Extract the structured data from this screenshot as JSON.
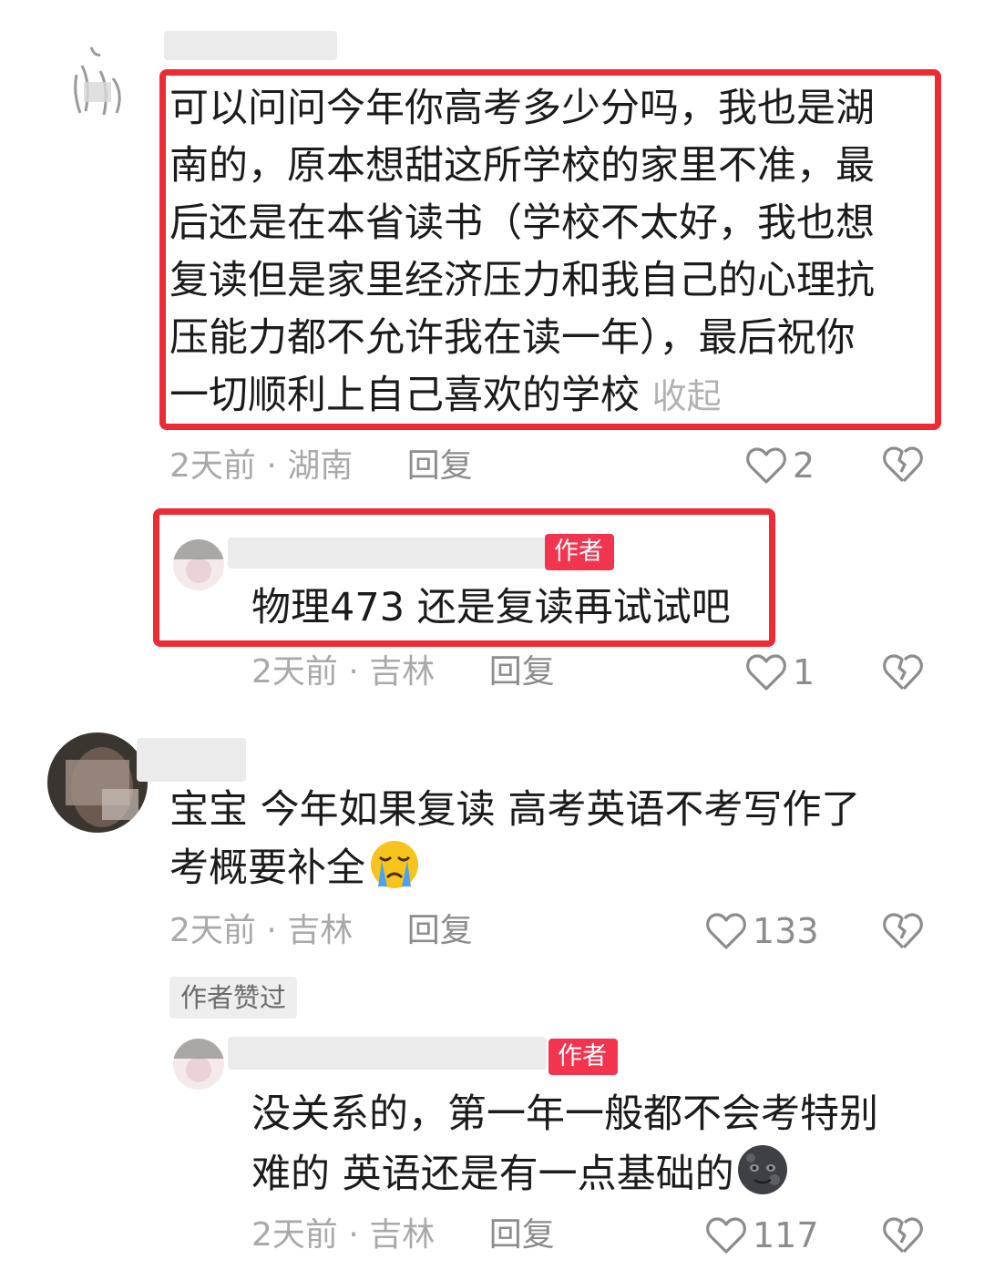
{
  "comments": [
    {
      "text": "可以问问今年你高考多少分吗，我也是湖南的，原本想甜这所学校的家里不准，最后还是在本省读书（学校不太好，我也想复读但是家里经济压力和我自己的心理抗压能力都不允许我在读一年），最后祝你一切顺利上自己喜欢的学校",
      "lines": [
        "可以问问今年你高考多少分吗，我也是湖",
        "南的，原本想甜这所学校的家里不准，最",
        "后还是在本省读书（学校不太好，我也想",
        "复读但是家里经济压力和我自己的心理抗",
        "压能力都不允许我在读一年），最后祝你",
        "一切顺利上自己喜欢的学校"
      ],
      "collapse_label": "收起",
      "time": "2天前",
      "location": "湖南",
      "reply_label": "回复",
      "likes": "2",
      "reply": {
        "author_tag": "作者",
        "text": "物理473 还是复读再试试吧",
        "time": "2天前",
        "location": "吉林",
        "reply_label": "回复",
        "likes": "1"
      }
    },
    {
      "lines": [
        "宝宝 今年如果复读 高考英语不考写作了",
        "考概要补全"
      ],
      "emoji": "crying-face",
      "time": "2天前",
      "location": "吉林",
      "reply_label": "回复",
      "likes": "133",
      "author_liked_badge": "作者赞过",
      "reply": {
        "author_tag": "作者",
        "lines": [
          "没关系的，第一年一般都不会考特别",
          "难的 英语还是有一点基础的"
        ],
        "emoji": "new-moon-face",
        "time": "2天前",
        "location": "吉林",
        "reply_label": "回复",
        "likes": "117"
      }
    }
  ],
  "meta_separator": "·",
  "colors": {
    "highlight_box": "#ee2b35",
    "author_tag": "#f2344f",
    "meta_text": "#a9a9a9"
  }
}
